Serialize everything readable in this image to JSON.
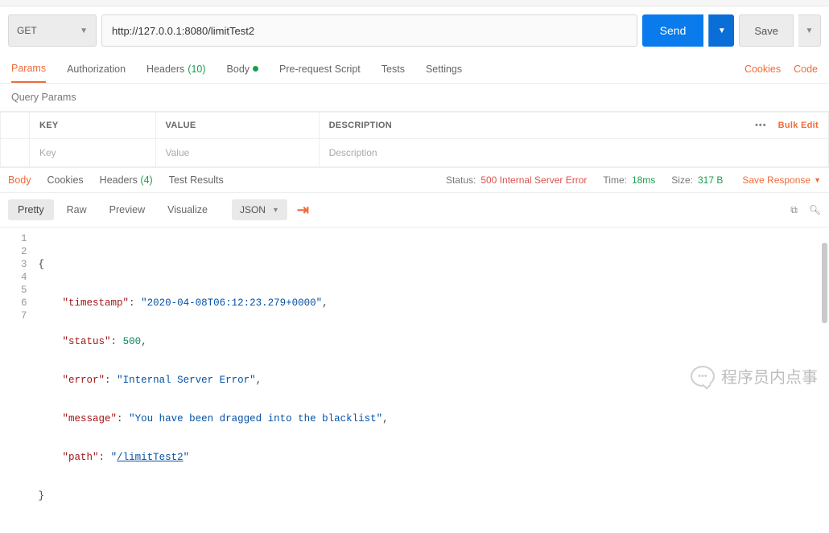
{
  "request": {
    "method": "GET",
    "url": "http://127.0.0.1:8080/limitTest2",
    "send_label": "Send",
    "save_label": "Save"
  },
  "tabs": {
    "params": "Params",
    "authorization": "Authorization",
    "headers": "Headers",
    "headers_count": "(10)",
    "body": "Body",
    "prerequest": "Pre-request Script",
    "tests": "Tests",
    "settings": "Settings",
    "cookies_link": "Cookies",
    "code_link": "Code"
  },
  "query": {
    "header": "Query Params",
    "key_header": "KEY",
    "value_header": "VALUE",
    "description_header": "DESCRIPTION",
    "key_placeholder": "Key",
    "value_placeholder": "Value",
    "description_placeholder": "Description",
    "dots": "•••",
    "bulk_edit": "Bulk Edit"
  },
  "response": {
    "tabs": {
      "body": "Body",
      "cookies": "Cookies",
      "headers": "Headers",
      "headers_count": "(4)",
      "test_results": "Test Results"
    },
    "status_label": "Status:",
    "status_value": "500 Internal Server Error",
    "time_label": "Time:",
    "time_value": "18ms",
    "size_label": "Size:",
    "size_value": "317 B",
    "save_response": "Save Response"
  },
  "viewer": {
    "pretty": "Pretty",
    "raw": "Raw",
    "preview": "Preview",
    "visualize": "Visualize",
    "format": "JSON"
  },
  "body_json": {
    "timestamp_key": "\"timestamp\"",
    "timestamp_val": "\"2020-04-08T06:12:23.279+0000\"",
    "status_key": "\"status\"",
    "status_val": "500",
    "error_key": "\"error\"",
    "error_val": "\"Internal Server Error\"",
    "message_key": "\"message\"",
    "message_val": "\"You have been dragged into the blacklist\"",
    "path_key": "\"path\"",
    "path_val_prefix": "\"",
    "path_val_link": "/limitTest2",
    "path_val_suffix": "\"",
    "line_nums": [
      "1",
      "2",
      "3",
      "4",
      "5",
      "6",
      "7"
    ]
  },
  "watermark": "程序员内点事"
}
